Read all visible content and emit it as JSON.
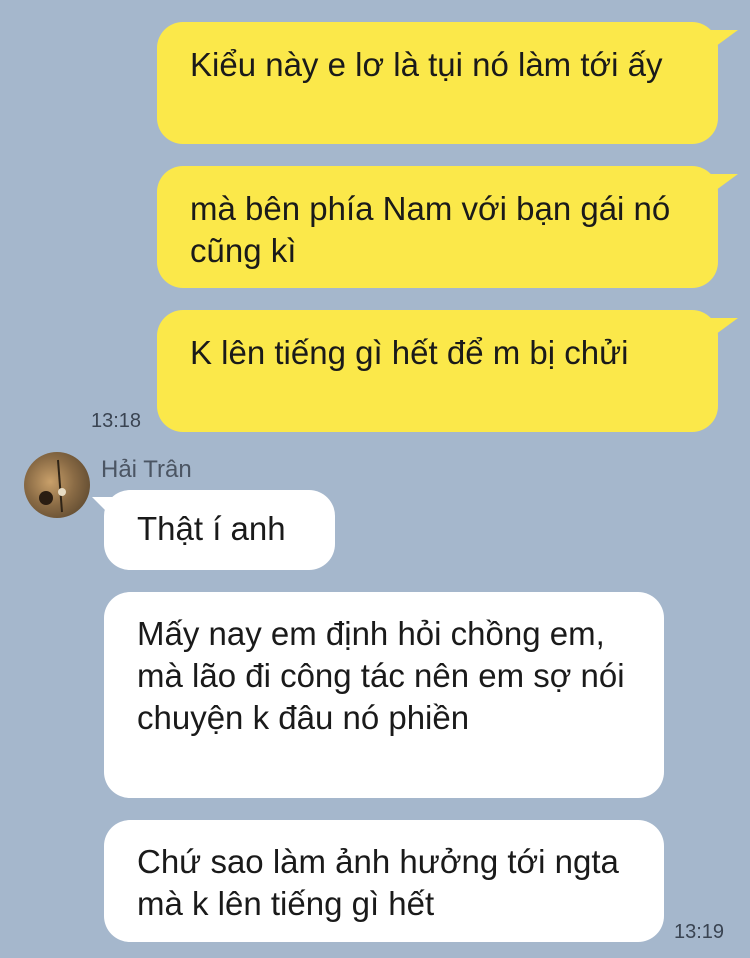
{
  "messages": [
    {
      "text": "Kiểu này e lơ là tụi nó làm tới ấy"
    },
    {
      "text": "mà bên phía Nam với bạn gái nó cũng kì"
    },
    {
      "text": "K lên tiếng gì hết để m bị chửi"
    },
    {
      "text": "Thật í anh"
    },
    {
      "text": "Mấy nay em định hỏi chồng em, mà lão đi công tác nên em sợ nói chuyện k đâu nó phiền"
    },
    {
      "text": "Chứ sao làm ảnh hưởng tới ngta mà k lên tiếng gì hết"
    }
  ],
  "timestamps": {
    "first": "13:18",
    "second": "13:19"
  },
  "contact": {
    "name": "Hải Trân",
    "avatar_icon": "avatar-photo"
  },
  "colors": {
    "background": "#a5b7cc",
    "sent_bubble": "#fbe84a",
    "received_bubble": "#ffffff"
  }
}
